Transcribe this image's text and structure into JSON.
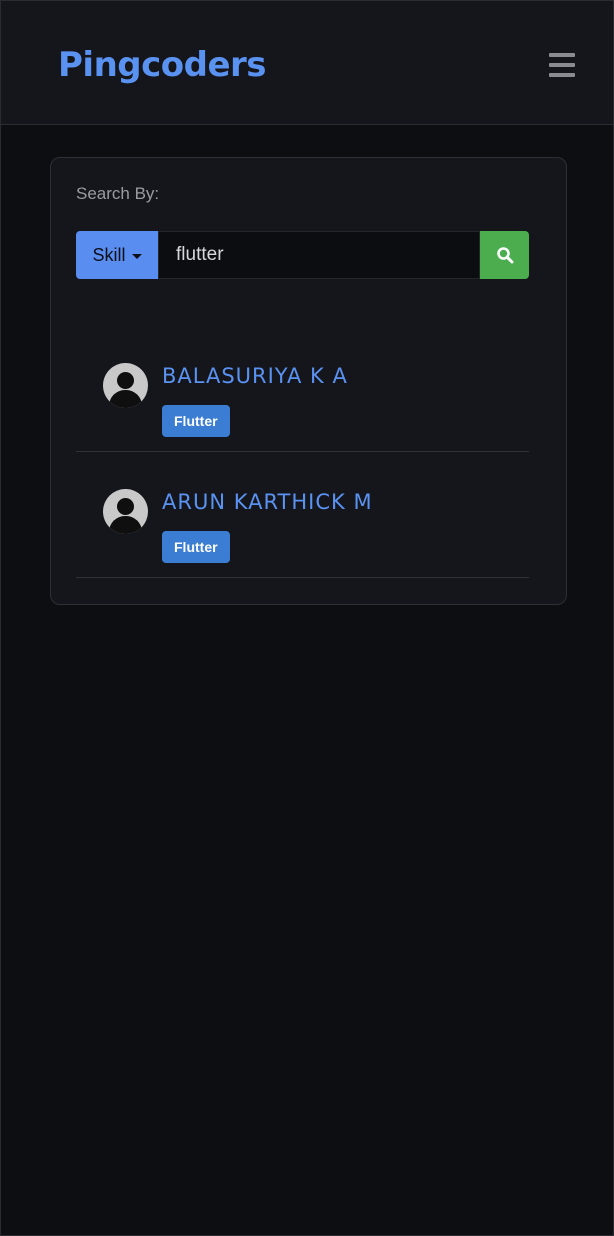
{
  "navbar": {
    "brand": "Pingcoders",
    "menu_icon": "hamburger-menu-icon"
  },
  "search": {
    "label": "Search By:",
    "filter_label": "Skill",
    "value": "flutter",
    "button_icon": "search-icon"
  },
  "results": [
    {
      "name": "BALASURIYA K A",
      "tag": "Flutter",
      "avatar_icon": "user-avatar-icon"
    },
    {
      "name": "ARUN KARTHICK M",
      "tag": "Flutter",
      "avatar_icon": "user-avatar-icon"
    }
  ],
  "colors": {
    "accent": "#5a92f2",
    "search_button": "#4cad4f",
    "tag": "#3b7dd2",
    "background": "#0d0e12"
  }
}
